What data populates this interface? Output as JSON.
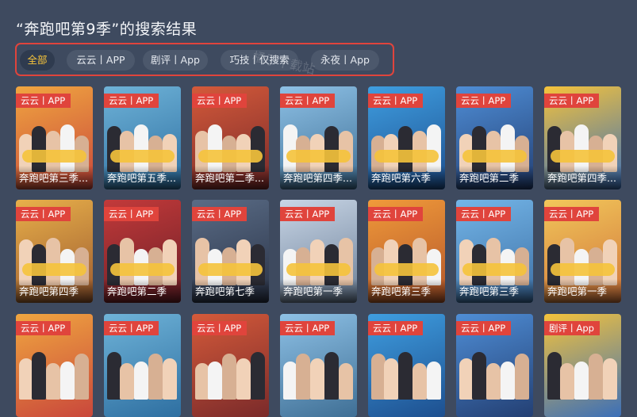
{
  "page": {
    "title": "“奔跑吧第9季”的搜索结果"
  },
  "watermark": "橘子下载站",
  "filters": [
    {
      "label": "全部",
      "active": true
    },
    {
      "label": "云云丨APP",
      "active": false
    },
    {
      "label": "剧评丨App",
      "active": false
    },
    {
      "label": "巧技丨仅搜索",
      "active": false
    },
    {
      "label": "永夜丨App",
      "active": false
    }
  ],
  "colors": {
    "background": "#3e4a5f",
    "accent": "#f5c33b",
    "tag": "#e0443c",
    "highlight_border": "#e0443c"
  },
  "results": [
    [
      {
        "tag": "云云丨APP",
        "name": "奔跑吧第三季..."
      },
      {
        "tag": "云云丨APP",
        "name": "奔跑吧第五季..."
      },
      {
        "tag": "云云丨APP",
        "name": "奔跑吧第二季..."
      },
      {
        "tag": "云云丨APP",
        "name": "奔跑吧第四季..."
      },
      {
        "tag": "云云丨APP",
        "name": "奔跑吧第六季"
      },
      {
        "tag": "云云丨APP",
        "name": "奔跑吧第二季"
      },
      {
        "tag": "云云丨APP",
        "name": "奔跑吧第四季..."
      }
    ],
    [
      {
        "tag": "云云丨APP",
        "name": "奔跑吧第四季"
      },
      {
        "tag": "云云丨APP",
        "name": "奔跑吧第二季"
      },
      {
        "tag": "云云丨APP",
        "name": "奔跑吧第七季"
      },
      {
        "tag": "云云丨APP",
        "name": "奔跑吧第一季"
      },
      {
        "tag": "云云丨APP",
        "name": "奔跑吧第三季"
      },
      {
        "tag": "云云丨APP",
        "name": "奔跑吧第三季"
      },
      {
        "tag": "云云丨APP",
        "name": "奔跑吧第一季"
      }
    ],
    [
      {
        "tag": "云云丨APP",
        "name": ""
      },
      {
        "tag": "云云丨APP",
        "name": ""
      },
      {
        "tag": "云云丨APP",
        "name": ""
      },
      {
        "tag": "云云丨APP",
        "name": ""
      },
      {
        "tag": "云云丨APP",
        "name": ""
      },
      {
        "tag": "云云丨APP",
        "name": ""
      },
      {
        "tag": "剧评丨App",
        "name": ""
      }
    ]
  ]
}
